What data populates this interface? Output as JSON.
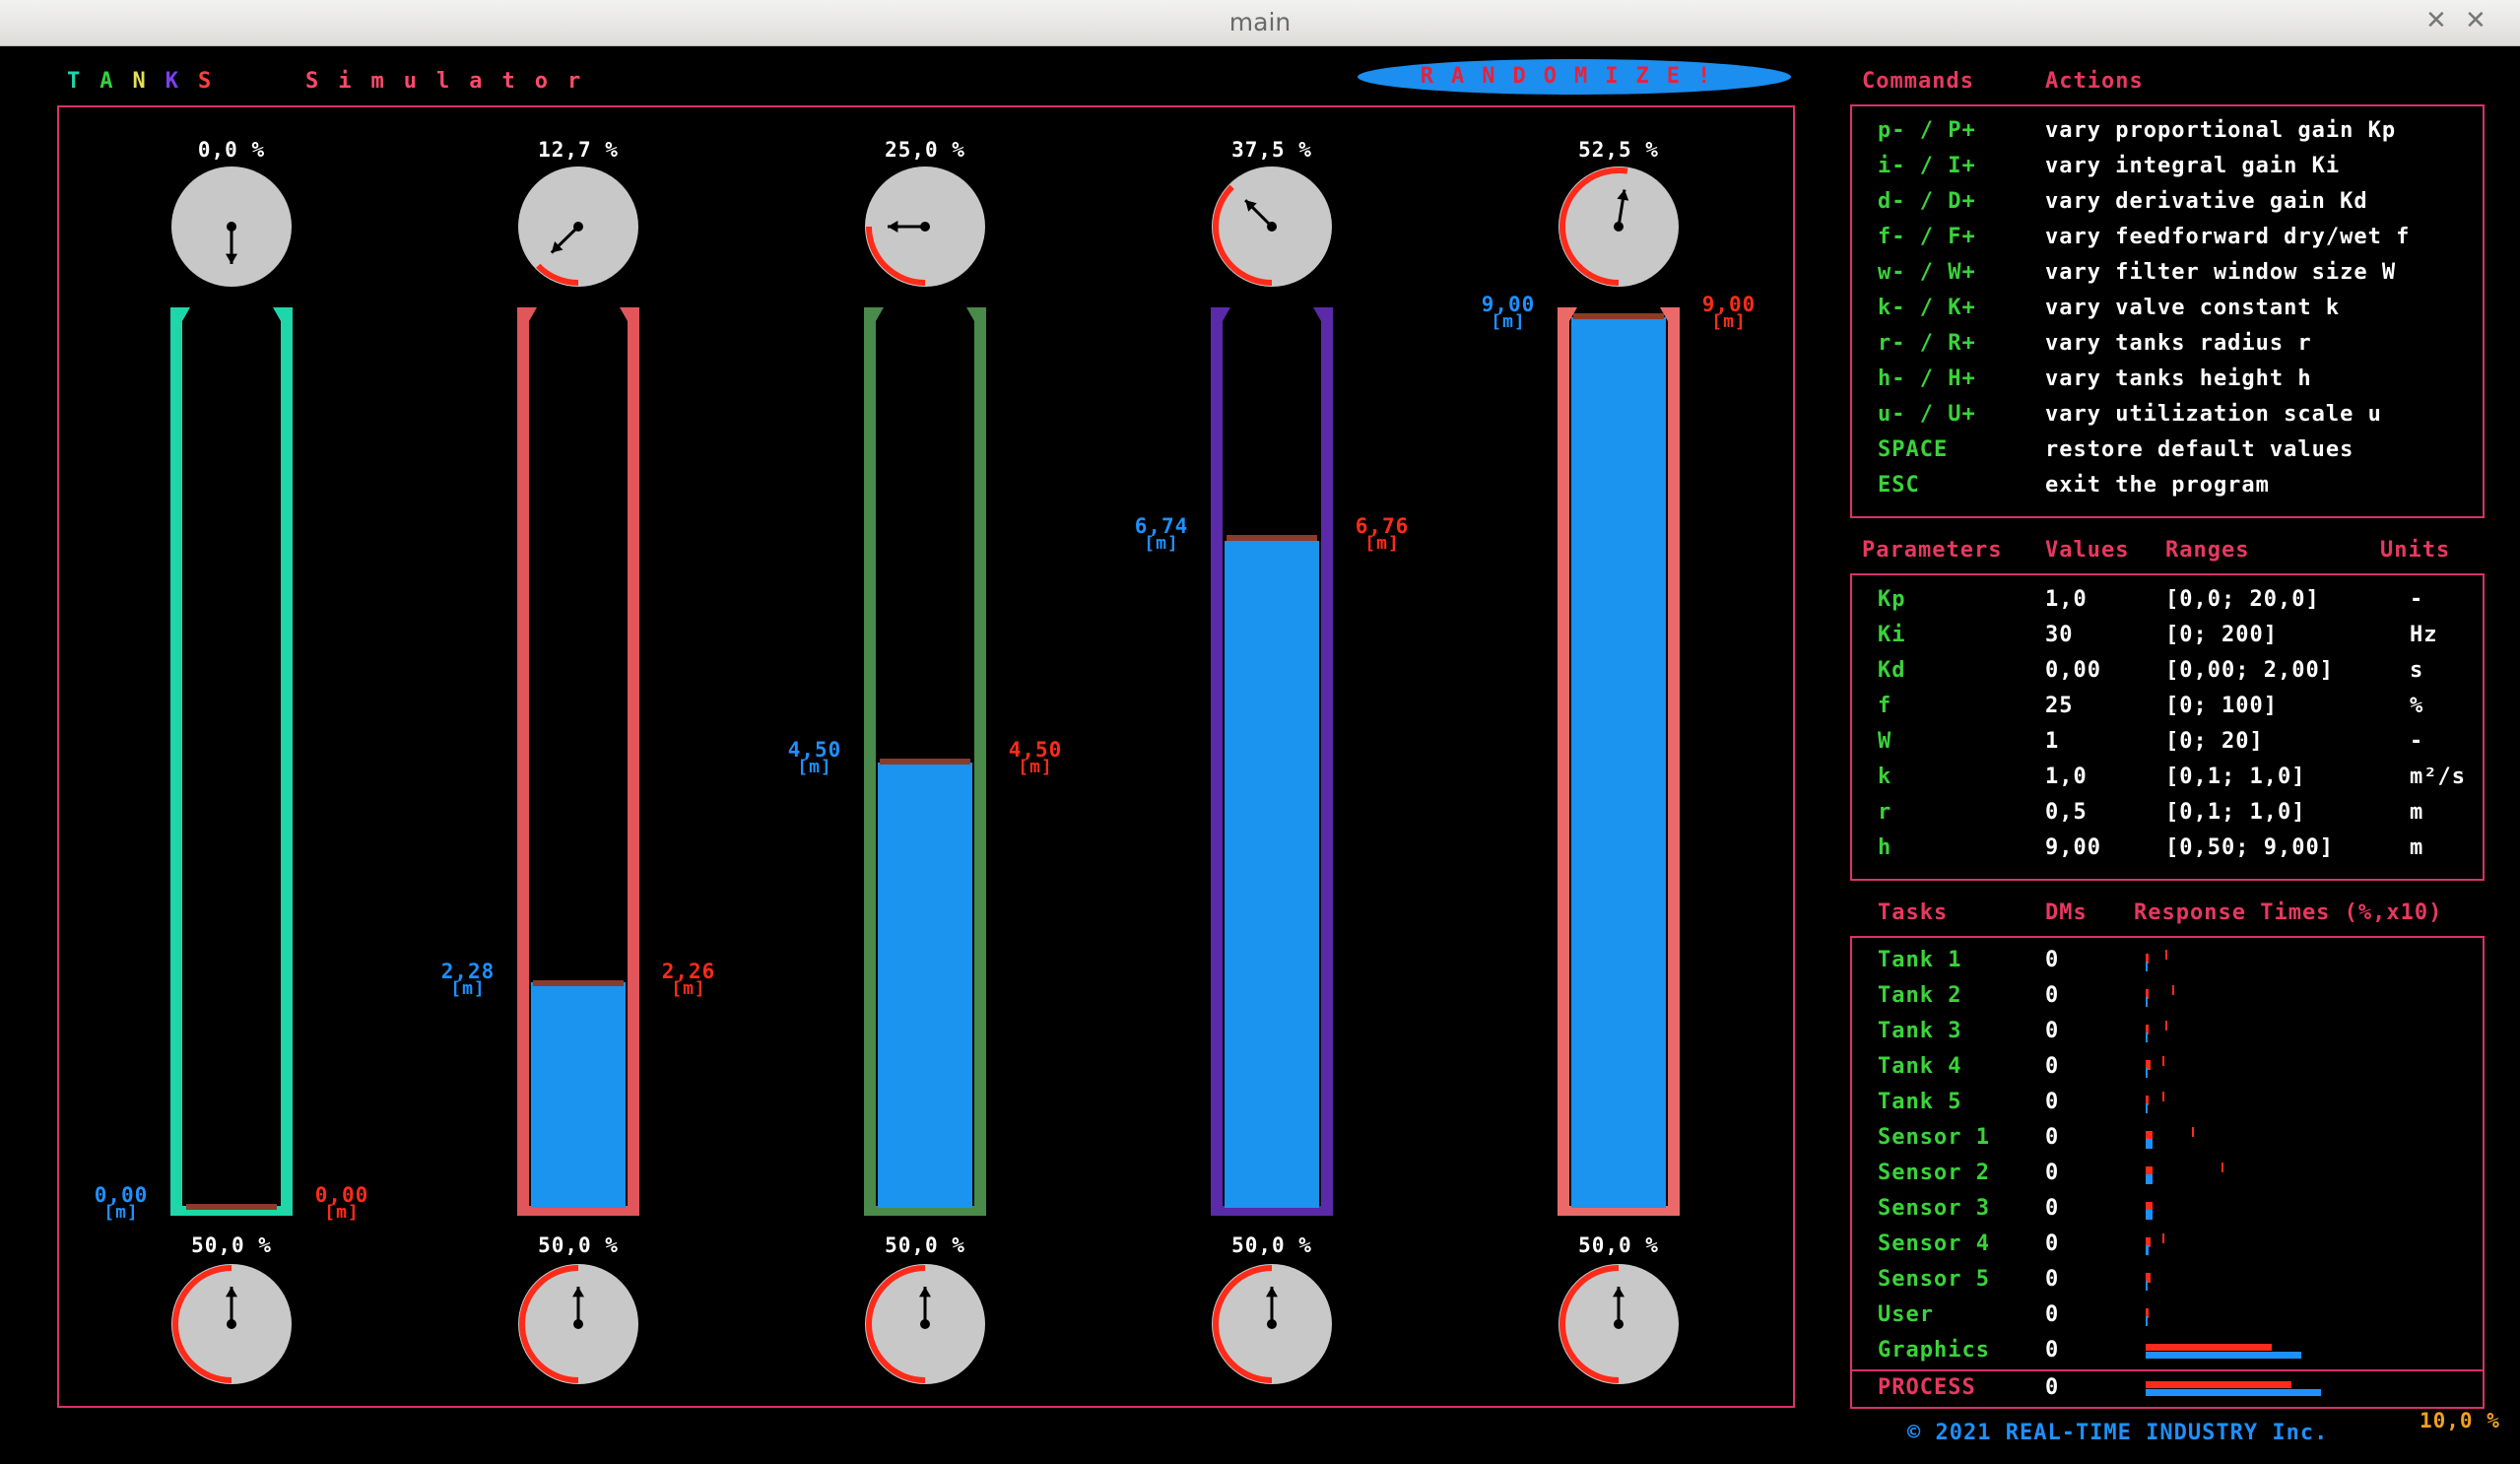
{
  "window": {
    "title": "main",
    "min_icon": "minimize-icon",
    "close_icon": "close-icon"
  },
  "app": {
    "title_letters": [
      {
        "ch": "T",
        "color": "#1ed6a8"
      },
      {
        "ch": "A",
        "color": "#34d23a"
      },
      {
        "ch": "N",
        "color": "#e2e05a"
      },
      {
        "ch": "K",
        "color": "#7b3ff0"
      },
      {
        "ch": "S",
        "color": "#ff4040"
      }
    ],
    "subtitle": "Simulator",
    "randomize_label": "RANDOMIZE!"
  },
  "tanks": [
    {
      "name": "Tank 1",
      "valve_top_pct": "0,0 %",
      "valve_bottom_pct": "50,0 %",
      "level_left": "0,00",
      "level_right": "0,00",
      "unit": "[m]",
      "fill_fraction": 0.0,
      "setpoint_fraction": 0.0,
      "tube_color": "#1ed6a8"
    },
    {
      "name": "Tank 2",
      "valve_top_pct": "12,7 %",
      "valve_bottom_pct": "50,0 %",
      "level_left": "2,28",
      "level_right": "2,26",
      "unit": "[m]",
      "fill_fraction": 0.253,
      "setpoint_fraction": 0.251,
      "tube_color": "#e0565a"
    },
    {
      "name": "Tank 3",
      "valve_top_pct": "25,0 %",
      "valve_bottom_pct": "50,0 %",
      "level_left": "4,50",
      "level_right": "4,50",
      "unit": "[m]",
      "fill_fraction": 0.5,
      "setpoint_fraction": 0.5,
      "tube_color": "#4a8a4a"
    },
    {
      "name": "Tank 4",
      "valve_top_pct": "37,5 %",
      "valve_bottom_pct": "50,0 %",
      "level_left": "6,74",
      "level_right": "6,76",
      "unit": "[m]",
      "fill_fraction": 0.749,
      "setpoint_fraction": 0.751,
      "tube_color": "#5a2aa8"
    },
    {
      "name": "Tank 5",
      "valve_top_pct": "52,5 %",
      "valve_bottom_pct": "50,0 %",
      "level_left": "9,00",
      "level_right": "9,00",
      "unit": "[m]",
      "fill_fraction": 1.0,
      "setpoint_fraction": 1.0,
      "tube_color": "#ea6a6a"
    }
  ],
  "valves_top_values": [
    0.0,
    0.127,
    0.25,
    0.375,
    0.525
  ],
  "valves_bottom_values": [
    0.5,
    0.5,
    0.5,
    0.5,
    0.5
  ],
  "commands": {
    "header_cmd": "Commands",
    "header_act": "Actions",
    "rows": [
      {
        "cmd": "p- / P+",
        "act": "vary proportional gain Kp"
      },
      {
        "cmd": "i- / I+",
        "act": "vary integral gain Ki"
      },
      {
        "cmd": "d- / D+",
        "act": "vary derivative gain Kd"
      },
      {
        "cmd": "f- / F+",
        "act": "vary feedforward dry/wet f"
      },
      {
        "cmd": "w- / W+",
        "act": "vary filter window size W"
      },
      {
        "cmd": "k- / K+",
        "act": "vary valve constant k"
      },
      {
        "cmd": "r- / R+",
        "act": "vary tanks radius r"
      },
      {
        "cmd": "h- / H+",
        "act": "vary tanks height h"
      },
      {
        "cmd": "u- / U+",
        "act": "vary utilization scale u"
      },
      {
        "cmd": "SPACE",
        "act": "restore default values"
      },
      {
        "cmd": "ESC",
        "act": "exit the program"
      }
    ]
  },
  "parameters": {
    "header_param": "Parameters",
    "header_values": "Values",
    "header_ranges": "Ranges",
    "header_units": "Units",
    "rows": [
      {
        "p": "Kp",
        "v": "1,0",
        "r": "[0,0; 20,0]",
        "u": "-"
      },
      {
        "p": "Ki",
        "v": "30",
        "r": "[0; 200]",
        "u": "Hz"
      },
      {
        "p": "Kd",
        "v": "0,00",
        "r": "[0,00; 2,00]",
        "u": "s"
      },
      {
        "p": "f",
        "v": "25",
        "r": "[0; 100]",
        "u": "%"
      },
      {
        "p": "W",
        "v": "1",
        "r": "[0; 20]",
        "u": "-"
      },
      {
        "p": "k",
        "v": "1,0",
        "r": "[0,1; 1,0]",
        "u": "m²/s"
      },
      {
        "p": "r",
        "v": "0,5",
        "r": "[0,1; 1,0]",
        "u": "m"
      },
      {
        "p": "h",
        "v": "9,00",
        "r": "[0,50; 9,00]",
        "u": "m"
      }
    ]
  },
  "tasks": {
    "header_tasks": "Tasks",
    "header_dms": "DMs",
    "header_resp": "Response Times (%,x10)",
    "rows": [
      {
        "name": "Tank 1",
        "dms": "0",
        "red": 0.01,
        "blue": 0.005,
        "mark": 0.06
      },
      {
        "name": "Tank 2",
        "dms": "0",
        "red": 0.01,
        "blue": 0.005,
        "mark": 0.08
      },
      {
        "name": "Tank 3",
        "dms": "0",
        "red": 0.01,
        "blue": 0.005,
        "mark": 0.06
      },
      {
        "name": "Tank 4",
        "dms": "0",
        "red": 0.015,
        "blue": 0.005,
        "mark": 0.05
      },
      {
        "name": "Tank 5",
        "dms": "0",
        "red": 0.01,
        "blue": 0.005,
        "mark": 0.05
      },
      {
        "name": "Sensor 1",
        "dms": "0",
        "red": 0.02,
        "blue": 0.02,
        "mark": 0.14
      },
      {
        "name": "Sensor 2",
        "dms": "0",
        "red": 0.02,
        "blue": 0.02,
        "mark": 0.23
      },
      {
        "name": "Sensor 3",
        "dms": "0",
        "red": 0.02,
        "blue": 0.02,
        "mark": 0.0
      },
      {
        "name": "Sensor 4",
        "dms": "0",
        "red": 0.015,
        "blue": 0.01,
        "mark": 0.05
      },
      {
        "name": "Sensor 5",
        "dms": "0",
        "red": 0.015,
        "blue": 0.005,
        "mark": 0.0
      },
      {
        "name": "User",
        "dms": "0",
        "red": 0.01,
        "blue": 0.005,
        "mark": 0.0
      },
      {
        "name": "Graphics",
        "dms": "0",
        "red": 0.38,
        "blue": 0.47,
        "mark": 0.0
      }
    ],
    "process": {
      "name": "PROCESS",
      "dms": "0",
      "red": 0.44,
      "blue": 0.53
    },
    "scale_label": "10,0 %"
  },
  "footer": "© 2021 REAL-TIME INDUSTRY Inc."
}
